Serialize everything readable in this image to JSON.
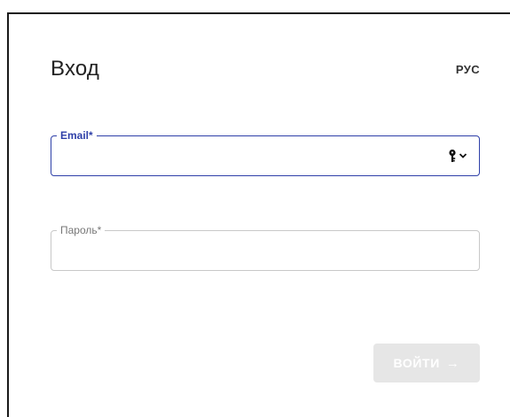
{
  "login": {
    "title": "Вход",
    "language": "РУС",
    "email": {
      "label": "Email*",
      "value": "",
      "placeholder": ""
    },
    "password": {
      "label": "Пароль*",
      "value": "",
      "placeholder": ""
    },
    "submit": {
      "label": "ВОЙТИ",
      "arrow": "→",
      "enabled": false
    },
    "icons": {
      "password_manager": "key-icon",
      "dropdown": "chevron-down-icon",
      "submit_arrow": "arrow-right-icon"
    },
    "colors": {
      "focus_accent": "#2e3fa8",
      "disabled_button": "#e6e6e6"
    }
  }
}
